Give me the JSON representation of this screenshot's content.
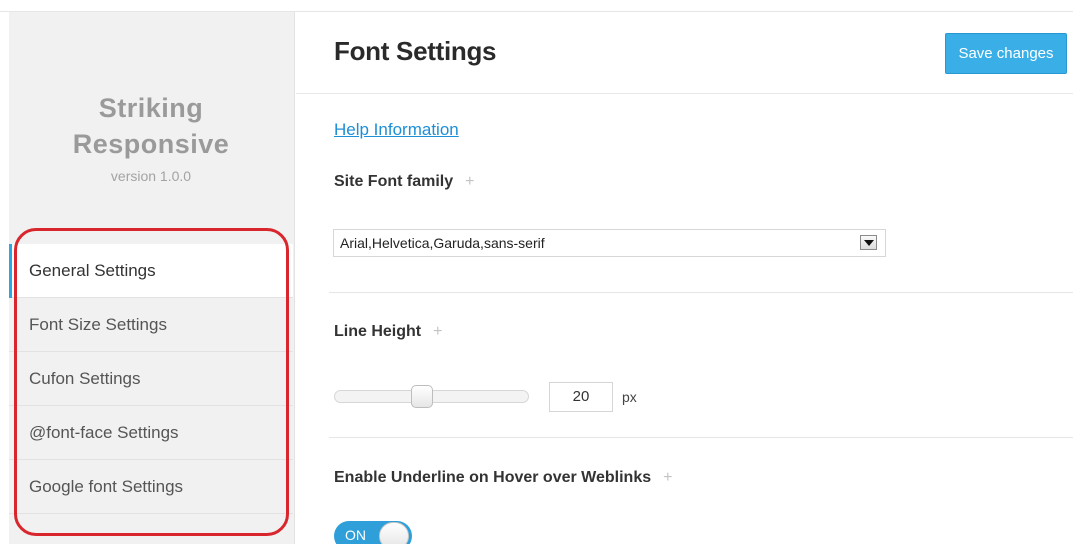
{
  "sidebar": {
    "brand_line1": "Striking",
    "brand_line2": "Responsive",
    "version": "version 1.0.0",
    "items": [
      {
        "label": "General Settings",
        "active": true
      },
      {
        "label": "Font Size Settings",
        "active": false
      },
      {
        "label": "Cufon Settings",
        "active": false
      },
      {
        "label": "@font-face Settings",
        "active": false
      },
      {
        "label": "Google font Settings",
        "active": false
      }
    ]
  },
  "header": {
    "title": "Font Settings",
    "save_label": "Save changes"
  },
  "main": {
    "help_link": "Help Information",
    "font_family": {
      "label": "Site Font family",
      "plus_icon": "plus-icon",
      "selected": "Arial,Helvetica,Garuda,sans-serif"
    },
    "line_height": {
      "label": "Line Height",
      "plus_icon": "plus-icon",
      "value": "20",
      "unit": "px"
    },
    "underline_hover": {
      "label": "Enable Underline on Hover over Weblinks",
      "plus_icon": "plus-icon",
      "toggle_text": "ON",
      "enabled": true
    }
  },
  "colors": {
    "accent": "#3aaee6",
    "link": "#1e8fd6",
    "highlight_annotation": "#d9262c"
  }
}
